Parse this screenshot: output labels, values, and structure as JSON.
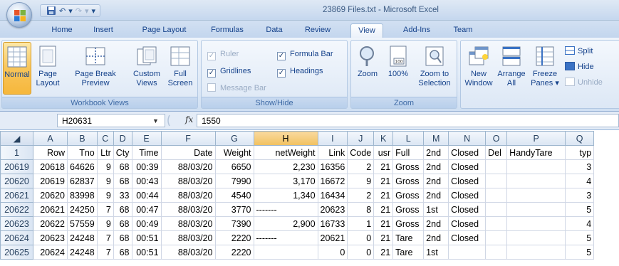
{
  "window": {
    "title": "23869 Files.txt - Microsoft Excel"
  },
  "qat": {
    "save_icon": "save-icon",
    "undo_symbol": "↶",
    "redo_symbol": "↷",
    "customize_symbol": "▾"
  },
  "tabs": [
    "Home",
    "Insert",
    "Page Layout",
    "Formulas",
    "Data",
    "Review",
    "View",
    "Add-Ins",
    "Team"
  ],
  "active_tab": "View",
  "ribbon": {
    "workbook_views": {
      "label": "Workbook Views",
      "normal": "Normal",
      "page_layout_1": "Page",
      "page_layout_2": "Layout",
      "page_break_1": "Page Break",
      "page_break_2": "Preview",
      "custom_views_1": "Custom",
      "custom_views_2": "Views",
      "full_screen_1": "Full",
      "full_screen_2": "Screen"
    },
    "show_hide": {
      "label": "Show/Hide",
      "ruler": "Ruler",
      "ruler_checked": "✓",
      "gridlines": "Gridlines",
      "gridlines_checked": "✓",
      "message_bar": "Message Bar",
      "message_bar_checked": "",
      "formula_bar": "Formula Bar",
      "formula_bar_checked": "✓",
      "headings": "Headings",
      "headings_checked": "✓"
    },
    "zoom": {
      "label": "Zoom",
      "zoom": "Zoom",
      "hundred": "100%",
      "zoom_sel_1": "Zoom to",
      "zoom_sel_2": "Selection"
    },
    "window": {
      "new_window_1": "New",
      "new_window_2": "Window",
      "arrange_1": "Arrange",
      "arrange_2": "All",
      "freeze_1": "Freeze",
      "freeze_2": "Panes ▾",
      "split": "Split",
      "hide": "Hide",
      "unhide": "Unhide"
    }
  },
  "formula_bar": {
    "name_box": "H20631",
    "fx": "fx",
    "value": "1550"
  },
  "grid": {
    "columns": [
      "A",
      "B",
      "C",
      "D",
      "E",
      "F",
      "G",
      "H",
      "I",
      "J",
      "K",
      "L",
      "M",
      "N",
      "O",
      "P",
      "Q"
    ],
    "selected_column": "H",
    "rows": [
      {
        "num": "1",
        "cells": [
          "Row",
          "Tno",
          "Ltr",
          "Cty",
          "Time",
          "Date",
          "Weight",
          "netWeight",
          "Link",
          "Code",
          "usr",
          "Full",
          "2nd",
          "Closed",
          "Del",
          "HandyTare",
          "typ"
        ]
      },
      {
        "num": "20619",
        "cells": [
          "20618",
          "64626",
          "9",
          "68",
          "00:39",
          "88/03/20",
          "6650",
          "2,230",
          "16356",
          "2",
          "21",
          "Gross",
          "2nd",
          "Closed",
          "",
          "",
          "3"
        ]
      },
      {
        "num": "20620",
        "cells": [
          "20619",
          "62837",
          "9",
          "68",
          "00:43",
          "88/03/20",
          "7990",
          "3,170",
          "16672",
          "9",
          "21",
          "Gross",
          "2nd",
          "Closed",
          "",
          "",
          "4"
        ]
      },
      {
        "num": "20621",
        "cells": [
          "20620",
          "83998",
          "9",
          "33",
          "00:44",
          "88/03/20",
          "4540",
          "1,340",
          "16434",
          "2",
          "21",
          "Gross",
          "2nd",
          "Closed",
          "",
          "",
          "3"
        ]
      },
      {
        "num": "20622",
        "cells": [
          "20621",
          "24250",
          "7",
          "68",
          "00:47",
          "88/03/20",
          "3770",
          "-------",
          "20623",
          "8",
          "21",
          "Gross",
          "1st",
          "Closed",
          "",
          "",
          "5"
        ]
      },
      {
        "num": "20623",
        "cells": [
          "20622",
          "57559",
          "9",
          "68",
          "00:49",
          "88/03/20",
          "7390",
          "2,900",
          "16733",
          "1",
          "21",
          "Gross",
          "2nd",
          "Closed",
          "",
          "",
          "4"
        ]
      },
      {
        "num": "20624",
        "cells": [
          "20623",
          "24248",
          "7",
          "68",
          "00:51",
          "88/03/20",
          "2220",
          "-------",
          "20621",
          "0",
          "21",
          "Tare",
          "2nd",
          "Closed",
          "",
          "",
          "5"
        ]
      },
      {
        "num": "20625",
        "cells": [
          "20624",
          "24248",
          "7",
          "68",
          "00:51",
          "88/03/20",
          "2220",
          "",
          "0",
          "0",
          "21",
          "Tare",
          "1st",
          "",
          "",
          "",
          "5"
        ]
      }
    ]
  }
}
